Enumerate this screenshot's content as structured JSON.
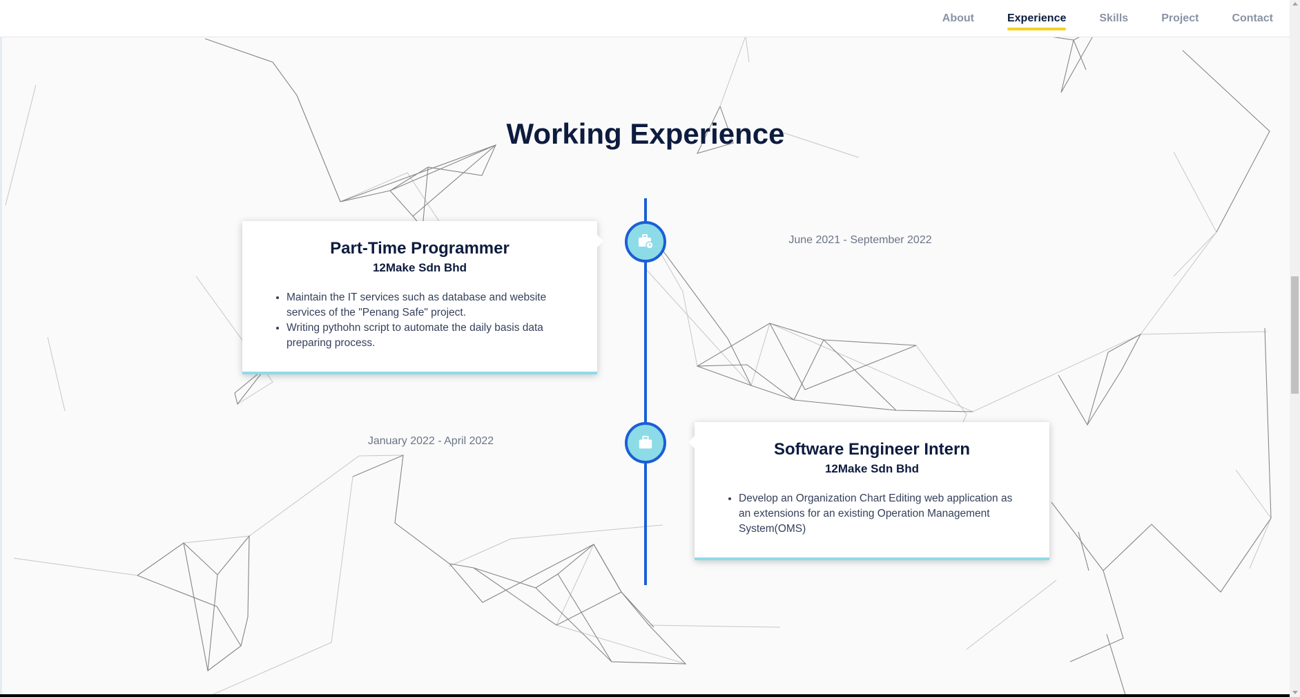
{
  "nav": {
    "items": [
      {
        "label": "About",
        "active": false
      },
      {
        "label": "Experience",
        "active": true
      },
      {
        "label": "Skills",
        "active": false
      },
      {
        "label": "Project",
        "active": false
      },
      {
        "label": "Contact",
        "active": false
      }
    ]
  },
  "section": {
    "title": "Working Experience"
  },
  "experiences": [
    {
      "title": "Part-Time Programmer",
      "company": "12Make Sdn Bhd",
      "date": "June 2021 - September 2022",
      "icon": "briefcase-clock-icon",
      "bullets": [
        "Maintain the IT services such as database and website services of the \"Penang Safe\" project.",
        "Writing pythohn script to automate the daily basis data preparing process."
      ]
    },
    {
      "title": "Software Engineer Intern",
      "company": "12Make Sdn Bhd",
      "date": "January 2022 - April 2022",
      "icon": "briefcase-icon",
      "bullets": [
        "Develop an Organization Chart Editing web application as an extensions for an existing Operation Management System(OMS)"
      ]
    }
  ],
  "colors": {
    "accent_blue": "#1a5fd6",
    "node_fill": "#8edbe8",
    "nav_underline": "#f5d020",
    "heading": "#0d1b3e"
  }
}
